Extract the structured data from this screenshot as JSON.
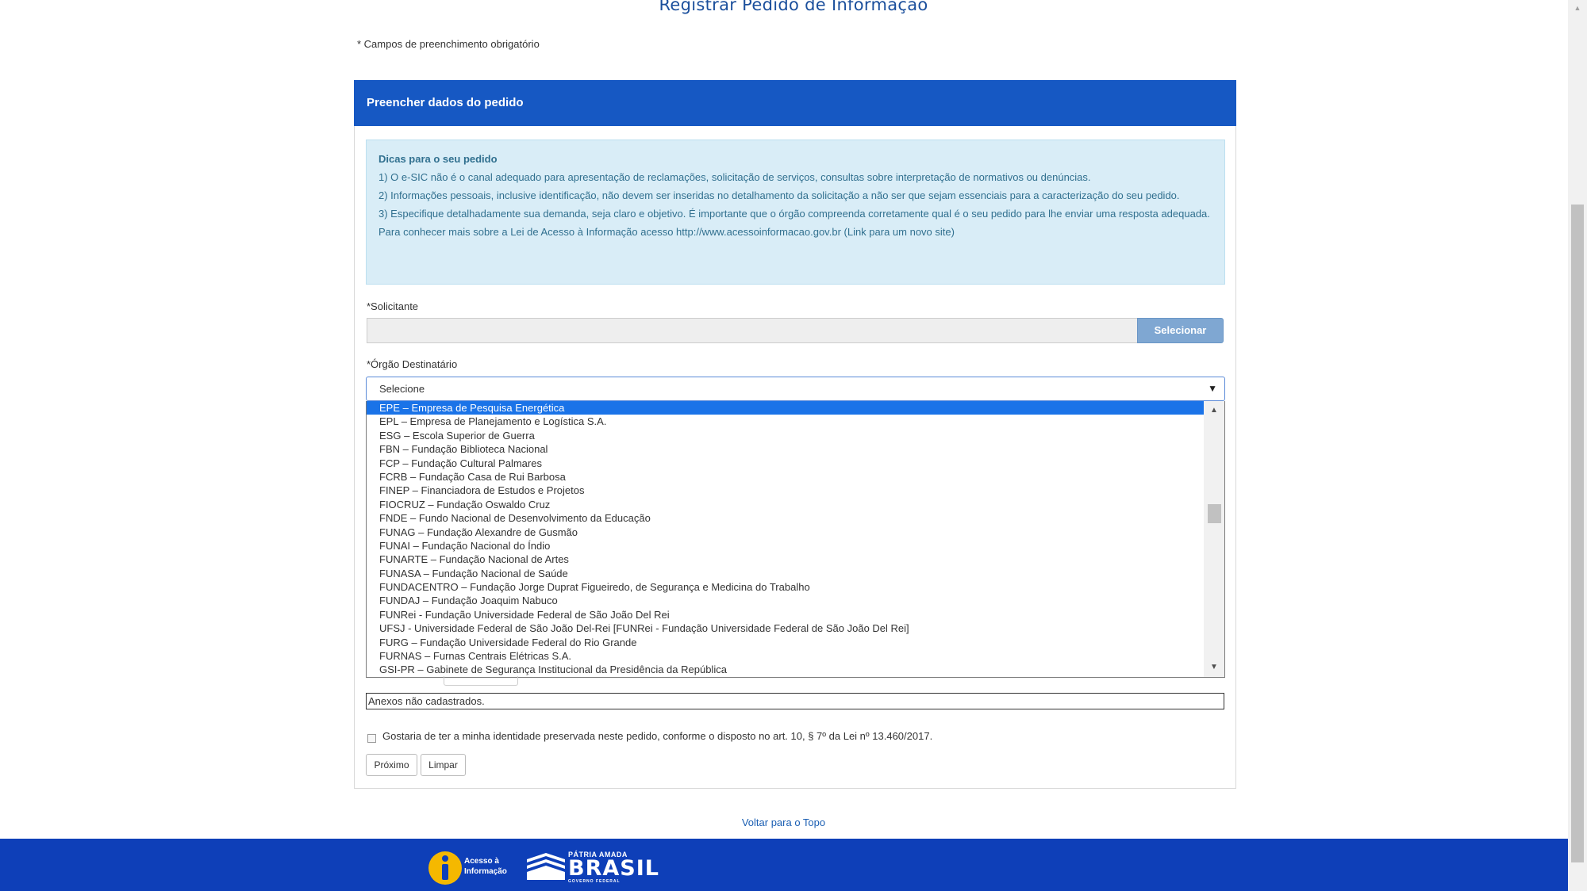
{
  "page": {
    "title": "Registrar Pedido de Informação",
    "required_note": "* Campos de preenchimento obrigatório",
    "back_to_top": "Voltar para o Topo"
  },
  "panel": {
    "header": "Preencher dados do pedido"
  },
  "tips": {
    "title": "Dicas para o seu pedido",
    "items": [
      "1) O e-SIC não é o canal adequado para apresentação de reclamações, solicitação de serviços, consultas sobre interpretação de normativos ou denúncias.",
      "2) Informações pessoais, inclusive identificação, não devem ser inseridas no detalhamento da solicitação a não ser que sejam essenciais para a caracterização do seu pedido.",
      "3) Especifique detalhadamente sua demanda, seja claro e objetivo. É importante que o órgão compreenda corretamente qual é o seu pedido para lhe enviar uma resposta adequada.",
      "Para conhecer mais sobre a Lei de Acesso à Informação acesso http://www.acessoinformacao.gov.br (Link para um novo site)"
    ]
  },
  "solicitante": {
    "label": "*Solicitante",
    "value": "",
    "button_label": "Selecionar"
  },
  "orgao": {
    "label": "*Órgão Destinatário",
    "selected": "Selecione",
    "options": [
      "EPE – Empresa de Pesquisa Energética",
      "EPL – Empresa de Planejamento e Logística S.A.",
      "ESG – Escola Superior de Guerra",
      "FBN – Fundação Biblioteca Nacional",
      "FCP – Fundação Cultural Palmares",
      "FCRB – Fundação Casa de Rui Barbosa",
      "FINEP – Financiadora de Estudos e Projetos",
      "FIOCRUZ – Fundação Oswaldo Cruz",
      "FNDE – Fundo Nacional de Desenvolvimento da Educação",
      "FUNAG – Fundação Alexandre de Gusmão",
      "FUNAI – Fundação Nacional do Índio",
      "FUNARTE – Fundação Nacional de Artes",
      "FUNASA – Fundação Nacional de Saúde",
      "FUNDACENTRO – Fundação Jorge Duprat Figueiredo, de Segurança e Medicina do Trabalho",
      "FUNDAJ – Fundação Joaquim Nabuco",
      "FUNRei - Fundação Universidade Federal de São João Del Rei",
      "UFSJ - Universidade Federal de São João Del-Rei [FUNRei - Fundação Universidade Federal de São João Del Rei]",
      "FURG – Fundação Universidade Federal do Rio Grande",
      "FURNAS – Furnas Centrais Elétricas S.A.",
      "GSI-PR – Gabinete de Segurança Institucional da Presidência da República"
    ],
    "highlighted_index": 0
  },
  "anexos": {
    "text": "Anexos não cadastrados."
  },
  "identity": {
    "label": "Gostaria de ter a minha identidade preservada neste pedido, conforme o disposto no art. 10, § 7º da Lei nº 13.460/2017.",
    "checked": false
  },
  "actions": {
    "next": "Próximo",
    "clear": "Limpar"
  },
  "footer": {
    "acesso_line1": "Acesso à",
    "acesso_line2": "Informação",
    "brasil_small": "PÁTRIA AMADA",
    "brasil_big": "BRASIL",
    "brasil_tiny": "GOVERNO FEDERAL"
  },
  "colors": {
    "header_blue": "#1658c3",
    "footer_blue": "#0e3fb8",
    "tips_bg": "#d9edf7",
    "select_button": "#7fa7d2",
    "highlight": "#1a73e8"
  }
}
